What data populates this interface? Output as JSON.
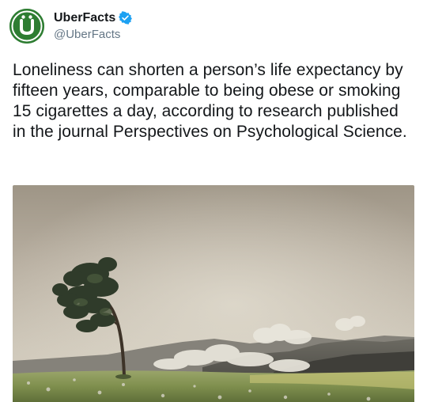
{
  "account": {
    "display_name": "UberFacts",
    "handle": "@UberFacts",
    "verified": true,
    "avatar_letter": "Ü",
    "avatar_color": "#2e7d32",
    "verified_color": "#1da1f2"
  },
  "tweet": {
    "text": "Loneliness can shorten a person’s life expectancy by fifteen years, comparable to being obese or smoking 15 cigarettes a day, according to research published in the journal Perspectives on Psychological Science."
  },
  "media": {
    "icon": "windswept-tree-landscape-photo"
  }
}
